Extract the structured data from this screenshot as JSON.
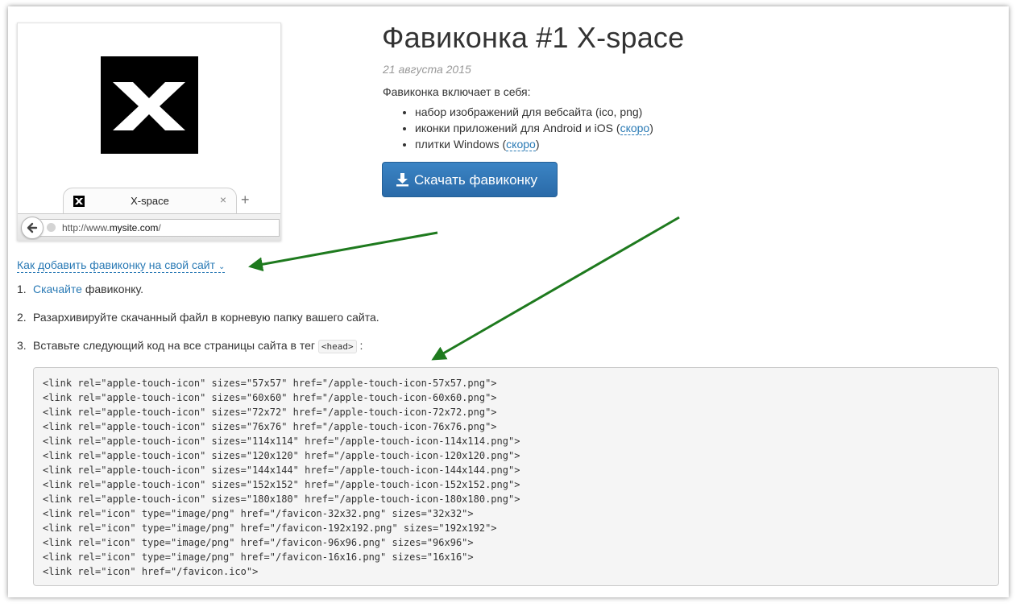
{
  "preview": {
    "tab_title": "X-space",
    "tab_close": "×",
    "new_tab": "+",
    "url_prefix": "http://www.",
    "url_domain": "mysite.com",
    "url_suffix": "/"
  },
  "header": {
    "title": "Фавиконка #1 X-space",
    "date": "21 августа 2015"
  },
  "features": {
    "intro": "Фавиконка включает в себя:",
    "items": [
      {
        "text": "набор изображений для вебсайта (ico, png)"
      },
      {
        "text": "иконки приложений для Android и iOS (",
        "link": "скоро",
        "after": ")"
      },
      {
        "text": "плитки Windows (",
        "link": "скоро",
        "after": ")"
      }
    ]
  },
  "download": {
    "label": "Скачать фавиконку",
    "icon": "download-icon"
  },
  "howto": {
    "toggle": "Как добавить фавиконку на свой сайт",
    "steps": [
      {
        "num": "1.",
        "link": "Скачайте",
        "text": " фавиконку."
      },
      {
        "num": "2.",
        "text": "Разархивируйте скачанный файл в корневую папку вашего сайта."
      },
      {
        "num": "3.",
        "text": "Вставьте следующий код на все страницы сайта в тег ",
        "code": "<head>",
        "after": " :"
      }
    ]
  },
  "code_lines": [
    "<link rel=\"apple-touch-icon\" sizes=\"57x57\" href=\"/apple-touch-icon-57x57.png\">",
    "<link rel=\"apple-touch-icon\" sizes=\"60x60\" href=\"/apple-touch-icon-60x60.png\">",
    "<link rel=\"apple-touch-icon\" sizes=\"72x72\" href=\"/apple-touch-icon-72x72.png\">",
    "<link rel=\"apple-touch-icon\" sizes=\"76x76\" href=\"/apple-touch-icon-76x76.png\">",
    "<link rel=\"apple-touch-icon\" sizes=\"114x114\" href=\"/apple-touch-icon-114x114.png\">",
    "<link rel=\"apple-touch-icon\" sizes=\"120x120\" href=\"/apple-touch-icon-120x120.png\">",
    "<link rel=\"apple-touch-icon\" sizes=\"144x144\" href=\"/apple-touch-icon-144x144.png\">",
    "<link rel=\"apple-touch-icon\" sizes=\"152x152\" href=\"/apple-touch-icon-152x152.png\">",
    "<link rel=\"apple-touch-icon\" sizes=\"180x180\" href=\"/apple-touch-icon-180x180.png\">",
    "<link rel=\"icon\" type=\"image/png\" href=\"/favicon-32x32.png\" sizes=\"32x32\">",
    "<link rel=\"icon\" type=\"image/png\" href=\"/favicon-192x192.png\" sizes=\"192x192\">",
    "<link rel=\"icon\" type=\"image/png\" href=\"/favicon-96x96.png\" sizes=\"96x96\">",
    "<link rel=\"icon\" type=\"image/png\" href=\"/favicon-16x16.png\" sizes=\"16x16\">",
    "<link rel=\"icon\" href=\"/favicon.ico\">"
  ],
  "colors": {
    "link": "#2a7ab5",
    "button": "#337ab7",
    "annotation_arrow": "#1e7a1e",
    "logo": "#000000"
  }
}
